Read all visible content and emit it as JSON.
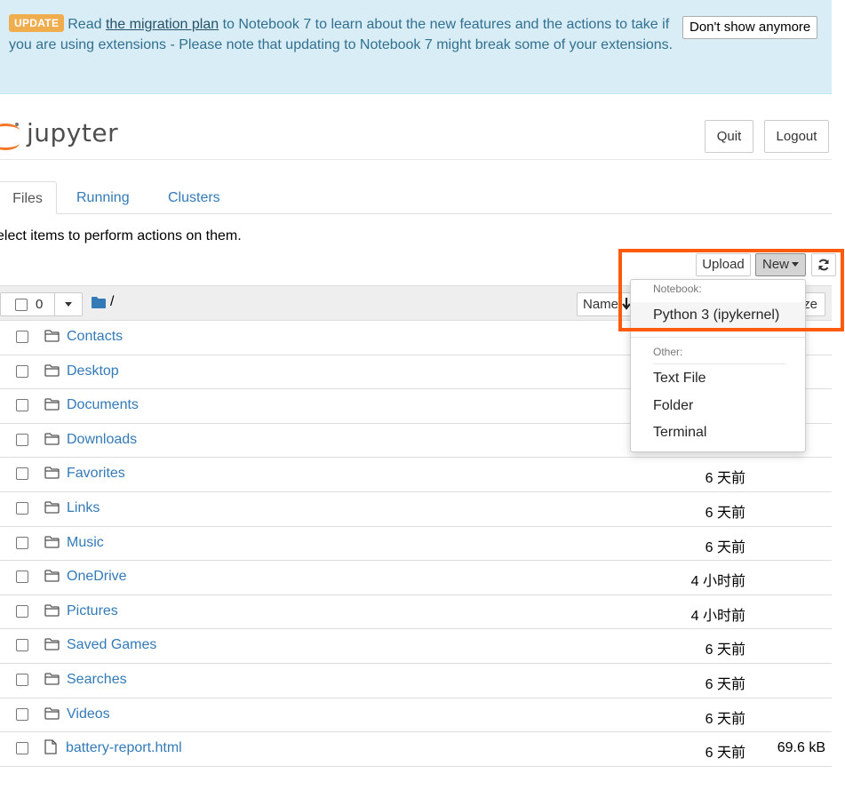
{
  "banner": {
    "badge": "UPDATE",
    "text_before": "Read ",
    "link": "the migration plan",
    "text_after": " to Notebook 7 to learn about the new features and the actions to take if you are using extensions - Please note that updating to Notebook 7 might break some of your extensions.",
    "dismiss_label": "Don't show anymore"
  },
  "header": {
    "logo_text": "jupyter",
    "quit_label": "Quit",
    "logout_label": "Logout"
  },
  "tabs": [
    {
      "label": "Files",
      "active": true
    },
    {
      "label": "Running",
      "active": false
    },
    {
      "label": "Clusters",
      "active": false
    }
  ],
  "hint": "elect items to perform actions on them.",
  "toolbar": {
    "upload_label": "Upload",
    "new_label": "New",
    "refresh_icon": "refresh-icon"
  },
  "list_header": {
    "selected_count": "0",
    "path": "/",
    "name_sort_label": "Name",
    "size_sort_label": "ze"
  },
  "rows": [
    {
      "name": "Contacts",
      "type": "folder",
      "time": "",
      "size": ""
    },
    {
      "name": "Desktop",
      "type": "folder",
      "time": "",
      "size": ""
    },
    {
      "name": "Documents",
      "type": "folder",
      "time": "",
      "size": ""
    },
    {
      "name": "Downloads",
      "type": "folder",
      "time": "",
      "size": ""
    },
    {
      "name": "Favorites",
      "type": "folder",
      "time": "6 天前",
      "size": ""
    },
    {
      "name": "Links",
      "type": "folder",
      "time": "6 天前",
      "size": ""
    },
    {
      "name": "Music",
      "type": "folder",
      "time": "6 天前",
      "size": ""
    },
    {
      "name": "OneDrive",
      "type": "folder",
      "time": "4 小时前",
      "size": ""
    },
    {
      "name": "Pictures",
      "type": "folder",
      "time": "4 小时前",
      "size": ""
    },
    {
      "name": "Saved Games",
      "type": "folder",
      "time": "6 天前",
      "size": ""
    },
    {
      "name": "Searches",
      "type": "folder",
      "time": "6 天前",
      "size": ""
    },
    {
      "name": "Videos",
      "type": "folder",
      "time": "6 天前",
      "size": ""
    },
    {
      "name": "battery-report.html",
      "type": "file",
      "time": "6 天前",
      "size": "69.6 kB"
    }
  ],
  "dropdown": {
    "notebook_header": "Notebook:",
    "python_kernel": "Python 3 (ipykernel)",
    "other_header": "Other:",
    "text_file": "Text File",
    "folder": "Folder",
    "terminal": "Terminal"
  },
  "colors": {
    "link": "#337ab7",
    "banner_bg": "#d9edf7",
    "badge": "#f0ad4e",
    "highlight": "#ff5a0a",
    "logo_orange": "#f37726"
  }
}
